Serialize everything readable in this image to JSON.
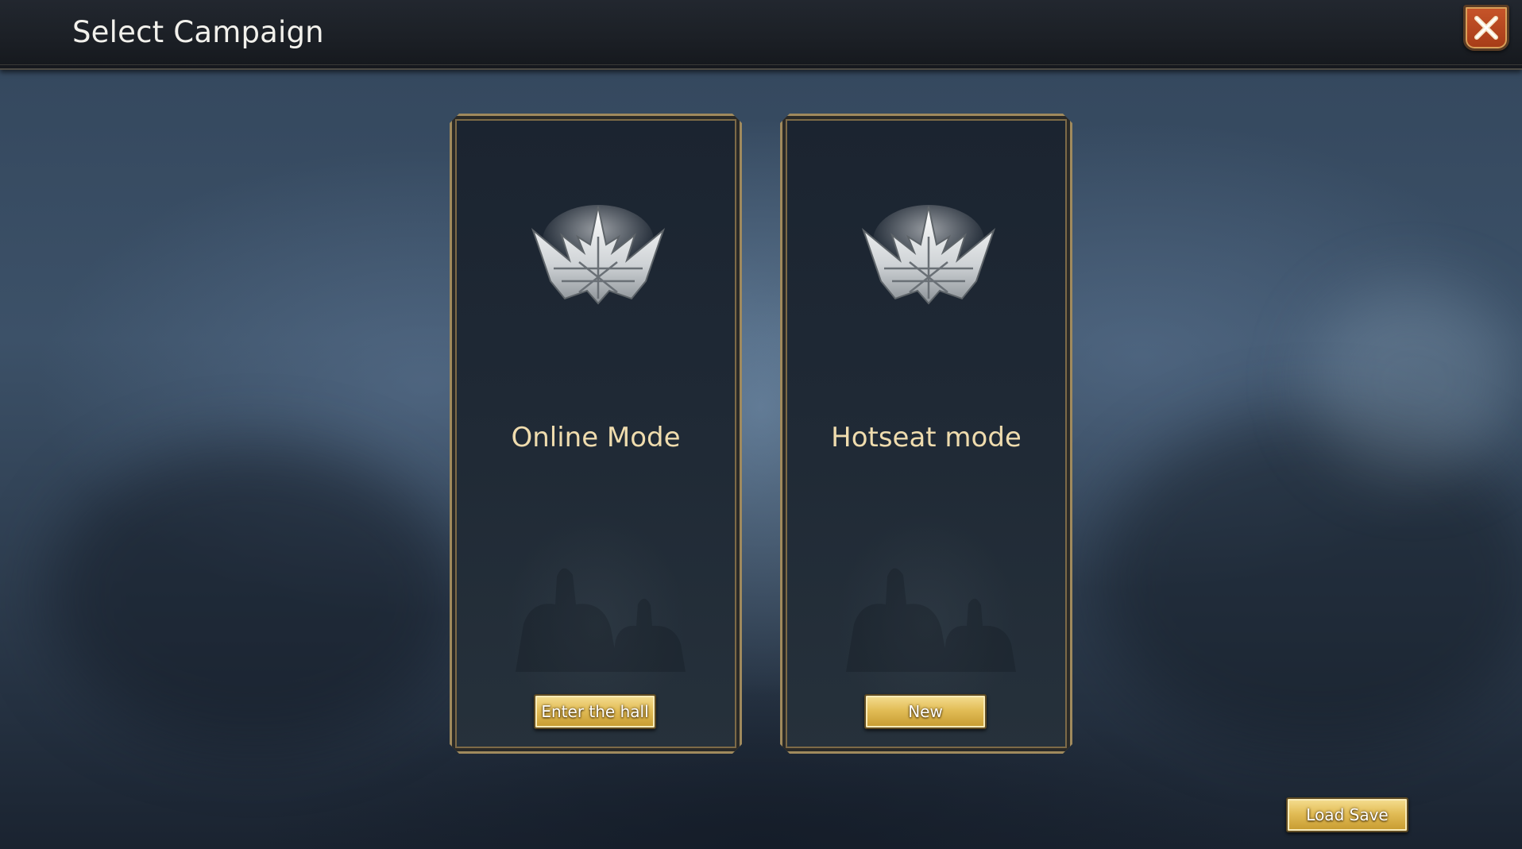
{
  "header": {
    "title": "Select Campaign"
  },
  "close": {
    "icon": "close-x-icon",
    "color": "#b9481f"
  },
  "cards": [
    {
      "title": "Online Mode",
      "button_label": "Enter the hall",
      "icon": "crown-icon"
    },
    {
      "title": "Hotseat mode",
      "button_label": "New",
      "icon": "crown-icon"
    }
  ],
  "footer": {
    "load_save_label": "Load Save"
  },
  "colors": {
    "accent_gold": "#e2bd57",
    "title_cream": "#efdcae",
    "frame_bronze": "#a08a5d"
  }
}
